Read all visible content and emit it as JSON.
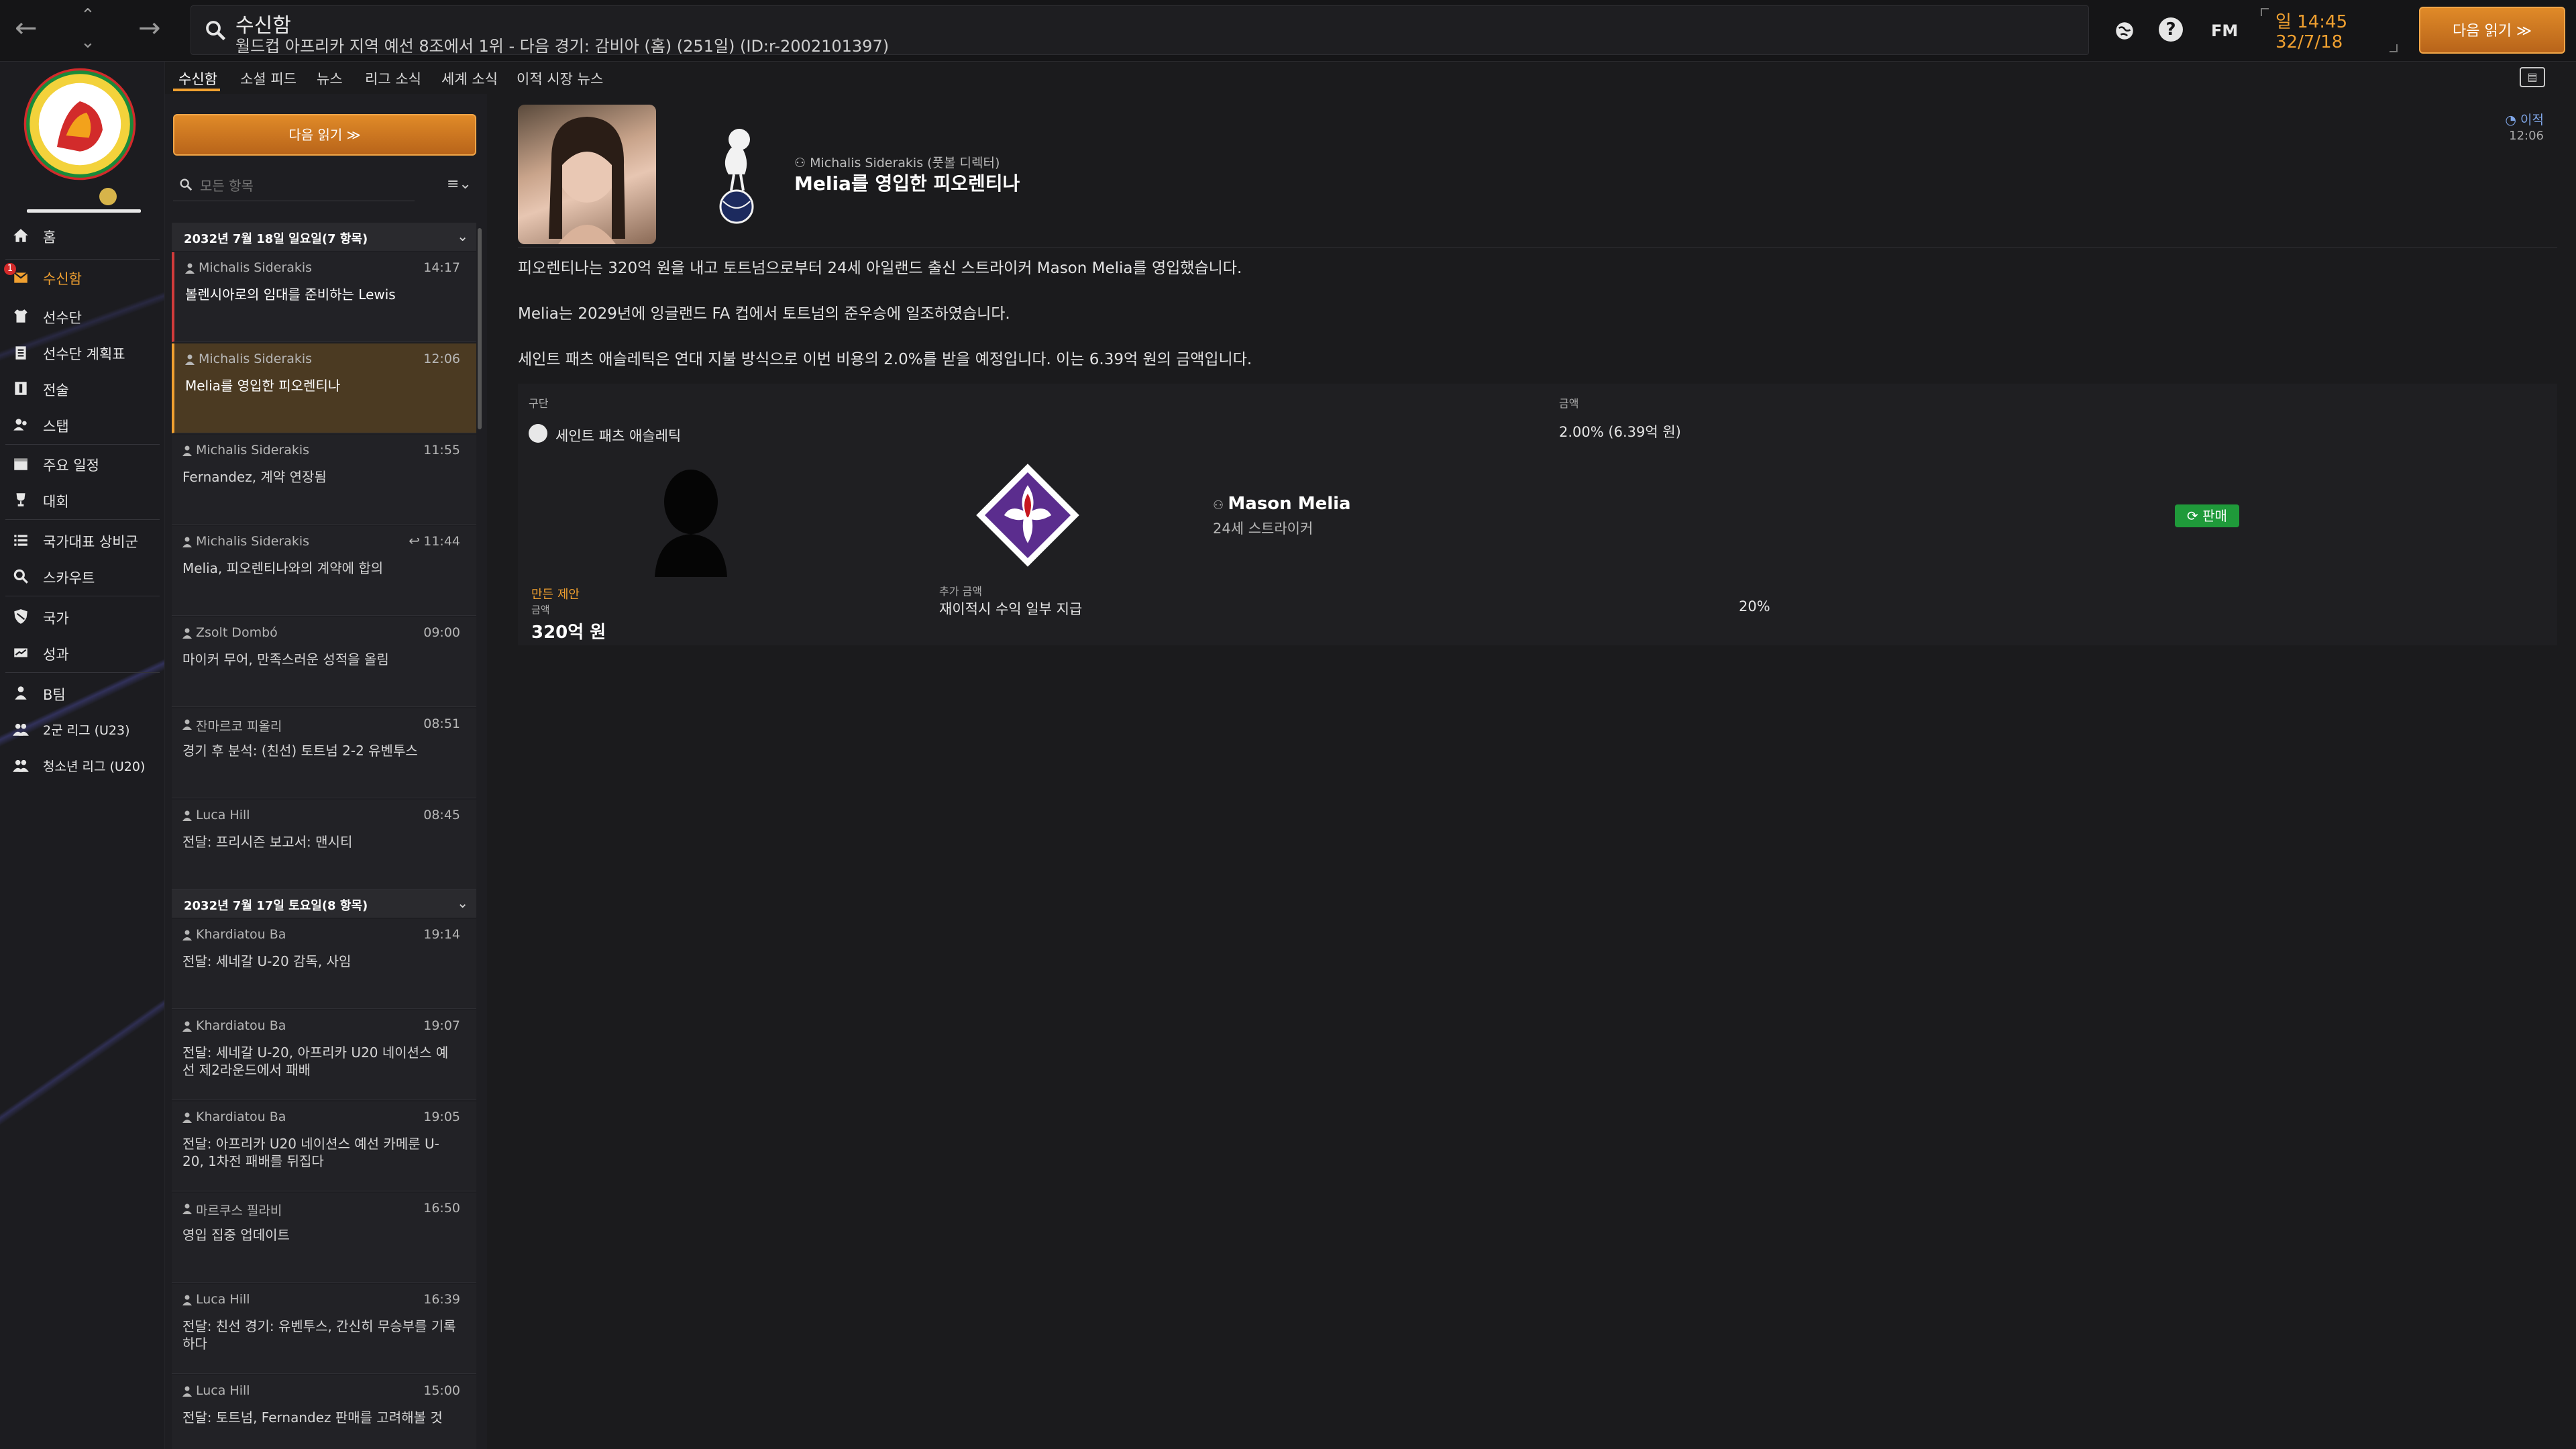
{
  "header": {
    "title": "수신함",
    "subtitle": "월드컵 아프리카 지역 예선 8조에서 1위 - 다음 경기: 감비아 (홈) (251일) (ID:r-2002101397)",
    "fm_label": "FM",
    "help_label": "?",
    "time": "일 14:45",
    "date": "32/7/18",
    "continue_label": "다음 읽기 ≫"
  },
  "sidebar": {
    "items": [
      {
        "label": "홈",
        "icon": "home-icon"
      },
      {
        "label": "수신함",
        "icon": "inbox-icon",
        "badge": "1"
      },
      {
        "label": "선수단",
        "icon": "shirt-icon"
      },
      {
        "label": "선수단 계획표",
        "icon": "clipboard-icon"
      },
      {
        "label": "전술",
        "icon": "tactics-icon"
      },
      {
        "label": "스탭",
        "icon": "staff-icon"
      },
      {
        "label": "주요 일정",
        "icon": "calendar-icon"
      },
      {
        "label": "대회",
        "icon": "trophy-icon"
      },
      {
        "label": "국가대표 상비군",
        "icon": "list-icon"
      },
      {
        "label": "스카우트",
        "icon": "scout-icon"
      },
      {
        "label": "국가",
        "icon": "shield-icon"
      },
      {
        "label": "성과",
        "icon": "performance-icon"
      },
      {
        "label": "B팀",
        "icon": "team-icon"
      },
      {
        "label": "2군 리그 (U23)",
        "icon": "team-icon"
      },
      {
        "label": "청소년 리그 (U20)",
        "icon": "team-icon"
      }
    ]
  },
  "tabs": [
    {
      "label": "수신함"
    },
    {
      "label": "소셜 피드"
    },
    {
      "label": "뉴스"
    },
    {
      "label": "리그 소식"
    },
    {
      "label": "세계 소식"
    },
    {
      "label": "이적 시장 뉴스"
    }
  ],
  "inbox": {
    "continue_label": "다음 읽기 ≫",
    "search_placeholder": "모든 항목",
    "filter_label": "≡⌄",
    "day1": {
      "label": "2032년 7월 18일 일요일(7 항목)"
    },
    "day2": {
      "label": "2032년 7월 17일 토요일(8 항목)"
    },
    "messages_day1": [
      {
        "sender": "Michalis Siderakis",
        "time": "14:17",
        "subject": "볼렌시아로의 임대를 준비하는 Lewis"
      },
      {
        "sender": "Michalis Siderakis",
        "time": "12:06",
        "subject": "Melia를 영입한 피오렌티나"
      },
      {
        "sender": "Michalis Siderakis",
        "time": "11:55",
        "subject": "Fernandez, 계약 연장됨"
      },
      {
        "sender": "Michalis Siderakis",
        "time": "11:44",
        "subject": "Melia, 피오렌티나와의 계약에 합의"
      },
      {
        "sender": "Zsolt Dombó",
        "time": "09:00",
        "subject": "마이커 무어, 만족스러운 성적을 올림"
      },
      {
        "sender": "잔마르코 피올리",
        "time": "08:51",
        "subject": "경기 후 분석: (친선) 토트넘 2-2 유벤투스"
      },
      {
        "sender": "Luca Hill",
        "time": "08:45",
        "subject": "전달: 프리시즌 보고서: 맨시티"
      }
    ],
    "messages_day2": [
      {
        "sender": "Khardiatou Ba",
        "time": "19:14",
        "subject": "전달: 세네갈 U-20 감독, 사임"
      },
      {
        "sender": "Khardiatou Ba",
        "time": "19:07",
        "subject": "전달: 세네갈 U-20, 아프리카 U20 네이션스 예선 제2라운드에서 패배"
      },
      {
        "sender": "Khardiatou Ba",
        "time": "19:05",
        "subject": "전달: 아프리카 U20 네이션스 예선 카메룬 U-20, 1차전 패배를 뒤집다"
      },
      {
        "sender": "마르쿠스 필라비",
        "time": "16:50",
        "subject": "영입 집중 업데이트"
      },
      {
        "sender": "Luca Hill",
        "time": "16:39",
        "subject": "전달: 친선 경기: 유벤투스, 간신히 무승부를 기록하다"
      },
      {
        "sender": "Luca Hill",
        "time": "15:00",
        "subject": "전달: 토트넘, Fernandez 판매를 고려해볼 것"
      }
    ]
  },
  "message": {
    "from": "Michalis Siderakis (풋볼 디렉터)",
    "title": "Melia를 영입한 피오렌티나",
    "tag": "이적",
    "time": "12:06",
    "paragraphs": [
      "피오렌티나는 320억 원을 내고 토트넘으로부터 24세 아일랜드 출신 스트라이커 Mason Melia를 영입했습니다.",
      "Melia는 2029년에 잉글랜드 FA 컵에서 토트넘의 준우승에 일조하였습니다.",
      "세인트 패츠 애슬레틱은 연대 지불 방식으로 이번 비용의 2.0%를 받을 예정입니다. 이는 6.39억 원의 금액입니다."
    ],
    "table": {
      "col1_label": "구단",
      "col2_label": "금액",
      "club": "세인트 패츠 애슬레틱",
      "club_amount": "2.00% (6.39억 원)",
      "player_name": "Mason Melia",
      "player_sub": "24세 스트라이커",
      "sell_label": "판매",
      "offer_label": "만든 제안",
      "amount_label": "금액",
      "amount_value": "320억 원",
      "extra_label": "추가 금액",
      "extra_value": "재이적시 수익 일부 지급",
      "extra_pct": "20%"
    }
  },
  "colors": {
    "accent": "#f0a030",
    "unread": "#d23b3b",
    "sell": "#1f9a3a",
    "background": "#1b1b1d"
  }
}
